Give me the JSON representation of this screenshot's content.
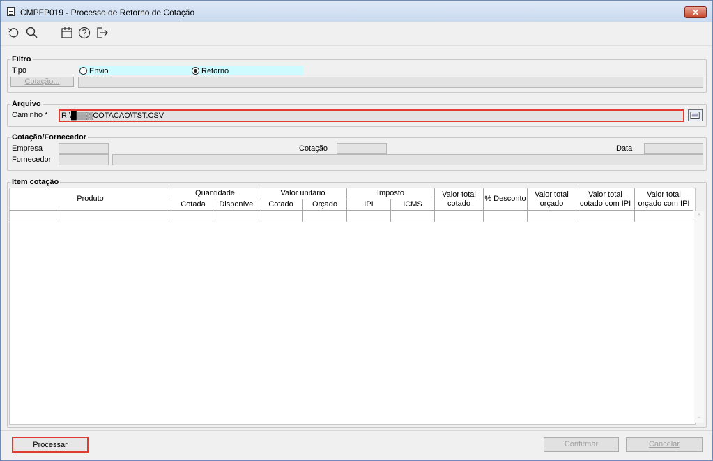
{
  "window": {
    "title": "CMPFP019 - Processo de Retorno de Cotação",
    "close_label": "✕"
  },
  "toolbar": {
    "icons": [
      "refresh-icon",
      "search-icon",
      "calendar-icon",
      "help-icon",
      "exit-icon"
    ]
  },
  "filtro": {
    "legend": "Filtro",
    "tipo_label": "Tipo",
    "options": [
      {
        "label": "Envio",
        "selected": false
      },
      {
        "label": "Retorno",
        "selected": true
      }
    ],
    "cotacao_button": "Cotação...",
    "cotacao_value": ""
  },
  "arquivo": {
    "legend": "Arquivo",
    "caminho_label": "Caminho *",
    "caminho_value": "R:\\█▒▒▒COTACAO\\TST.CSV"
  },
  "cotacao_fornecedor": {
    "legend": "Cotação/Fornecedor",
    "empresa_label": "Empresa",
    "cotacao_label": "Cotação",
    "data_label": "Data",
    "fornecedor_label": "Fornecedor",
    "empresa_value": "",
    "cotacao_value": "",
    "data_value": "",
    "fornecedor_code": "",
    "fornecedor_name": ""
  },
  "item_cotacao": {
    "legend": "Item cotação",
    "headers": {
      "produto": "Produto",
      "quantidade": "Quantidade",
      "cotada": "Cotada",
      "disponivel": "Disponível",
      "valor_unitario": "Valor unitário",
      "cotado": "Cotado",
      "orcado": "Orçado",
      "imposto": "Imposto",
      "ipi": "IPI",
      "icms": "ICMS",
      "valor_total_cotado": "Valor total cotado",
      "desconto": "% Desconto",
      "valor_total_orcado": "Valor total orçado",
      "valor_total_cotado_ipi": "Valor total cotado com IPI",
      "valor_total_orcado_ipi": "Valor total orçado com IPI"
    },
    "rows": [
      [
        "",
        "",
        "",
        "",
        "",
        "",
        "",
        "",
        "",
        "",
        "",
        "",
        ""
      ]
    ]
  },
  "footer": {
    "processar": "Processar",
    "confirmar": "Confirmar",
    "cancelar": "Cancelar"
  },
  "colors": {
    "highlight_border": "#e03c31",
    "radio_bg": "#cdfbff"
  }
}
